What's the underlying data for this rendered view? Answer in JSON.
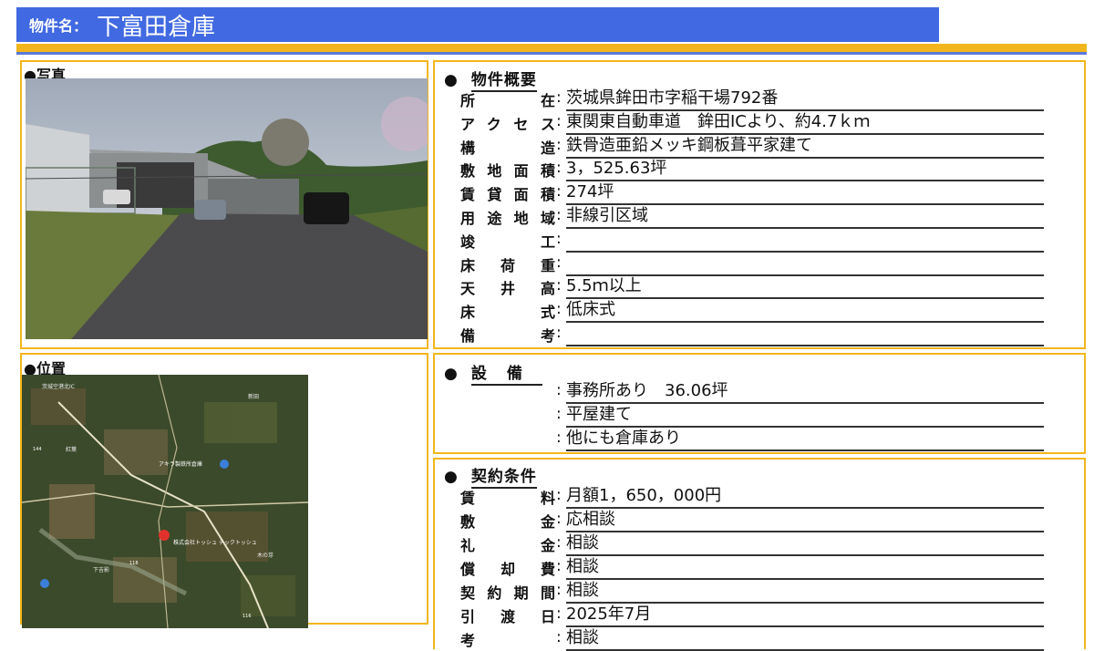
{
  "header": {
    "label": "物件名：",
    "name": "下富田倉庫"
  },
  "photo_section": {
    "title": "●写真"
  },
  "map_section": {
    "title": "●位置",
    "labels": [
      "茨城空港北IC",
      "紅葉",
      "新田",
      "木の芽",
      "下吉影",
      "118",
      "144",
      "116"
    ],
    "pin_label": "株式会社トッシュ テックトッシュ",
    "road_label": "アキラ製鉄所倉庫"
  },
  "overview": {
    "title": "物件概要",
    "rows": [
      {
        "key": "所在",
        "value": "茨城県鉾田市字稲干場792番"
      },
      {
        "key": "アクセス",
        "value": "東関東自動車道　鉾田ICより、約4.7ｋｍ"
      },
      {
        "key": "構造",
        "value": "鉄骨造亜鉛メッキ鋼板葺平家建て"
      },
      {
        "key": "敷地面積",
        "value": "3，525.63坪"
      },
      {
        "key": "賃貸面積",
        "value": "274坪"
      },
      {
        "key": "用途地域",
        "value": "非線引区域"
      },
      {
        "key": "竣工",
        "value": ""
      },
      {
        "key": "床荷重",
        "value": ""
      },
      {
        "key": "天井高",
        "value": "5.5ｍ以上"
      },
      {
        "key": "床式",
        "value": "低床式"
      },
      {
        "key": "備考",
        "value": ""
      }
    ]
  },
  "equipment": {
    "title": "設備",
    "rows": [
      {
        "key": "",
        "value": "事務所あり　36.06坪"
      },
      {
        "key": "",
        "value": "平屋建て"
      },
      {
        "key": "",
        "value": "他にも倉庫あり"
      }
    ]
  },
  "contract": {
    "title": "契約条件",
    "rows": [
      {
        "key": "賃料",
        "value": "月額1，650，000円"
      },
      {
        "key": "敷金",
        "value": "応相談"
      },
      {
        "key": "礼金",
        "value": "相談"
      },
      {
        "key": "償却費",
        "value": "相談"
      },
      {
        "key": "契約期間",
        "value": "相談"
      },
      {
        "key": "引渡日",
        "value": "2025年7月"
      },
      {
        "key": "考",
        "value": "相談"
      }
    ]
  }
}
